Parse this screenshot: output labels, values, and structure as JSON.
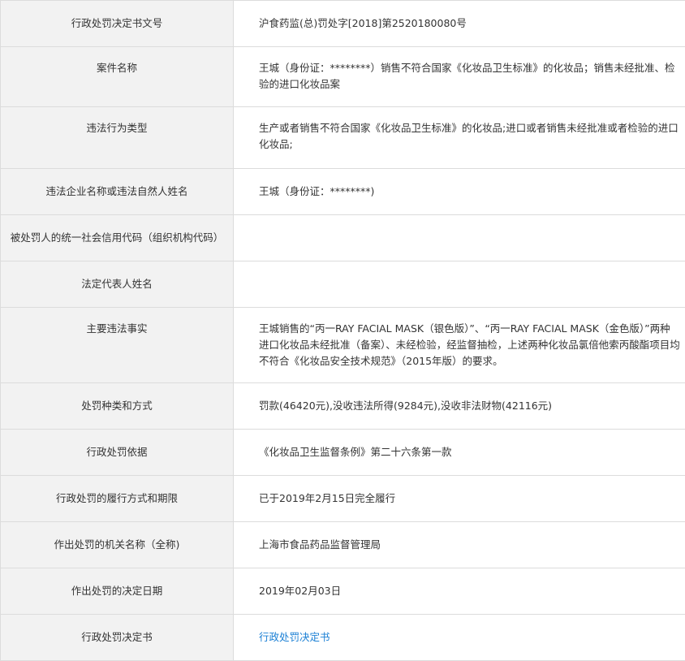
{
  "rows": [
    {
      "label": "行政处罚决定书文号",
      "value": "沪食药监(总)罚处字[2018]第2520180080号"
    },
    {
      "label": "案件名称",
      "value": "王城（身份证：********）销售不符合国家《化妆品卫生标准》的化妆品；销售未经批准、检验的进口化妆品案"
    },
    {
      "label": "违法行为类型",
      "value": "生产或者销售不符合国家《化妆品卫生标准》的化妆品;进口或者销售未经批准或者检验的进口化妆品;"
    },
    {
      "label": "违法企业名称或违法自然人姓名",
      "value": "王城（身份证：********)"
    },
    {
      "label": "被处罚人的统一社会信用代码（组织机构代码）",
      "value": ""
    },
    {
      "label": "法定代表人姓名",
      "value": ""
    },
    {
      "label": "主要违法事实",
      "value": "王城销售的“丙一RAY FACIAL MASK（银色版）”、“丙一RAY FACIAL MASK（金色版）”两种进口化妆品未经批准（备案）、未经检验，经监督抽检，上述两种化妆品氯倍他索丙酸酯项目均不符合《化妆品安全技术规范》（2015年版）的要求。"
    },
    {
      "label": "处罚种类和方式",
      "value": "罚款(46420元),没收违法所得(9284元),没收非法财物(42116元)"
    },
    {
      "label": "行政处罚依据",
      "value": "《化妆品卫生监督条例》第二十六条第一款"
    },
    {
      "label": "行政处罚的履行方式和期限",
      "value": "已于2019年2月15日完全履行"
    },
    {
      "label": "作出处罚的机关名称（全称)",
      "value": "上海市食品药品监督管理局"
    },
    {
      "label": "作出处罚的决定日期",
      "value": "2019年02月03日"
    },
    {
      "label": "行政处罚决定书",
      "value": "行政处罚决定书"
    }
  ],
  "colors": {
    "label_background": "#f2f2f2",
    "border": "#dcdcdc",
    "text": "#333333",
    "link": "#1a7fd4"
  }
}
